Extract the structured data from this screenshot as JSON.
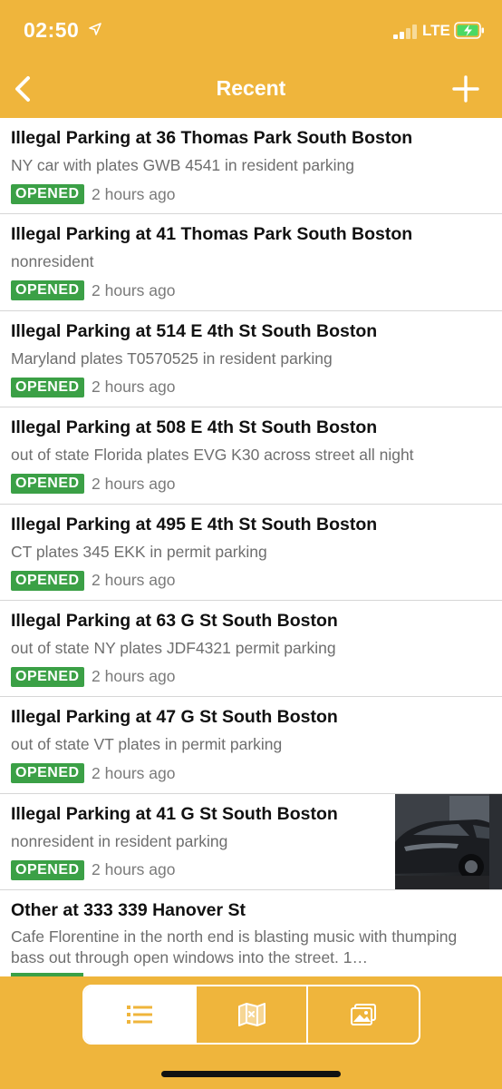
{
  "status_bar": {
    "time": "02:50",
    "network": "LTE"
  },
  "nav": {
    "title": "Recent"
  },
  "reports": [
    {
      "title": "Illegal Parking at 36 Thomas Park South Boston",
      "description": "NY car with plates GWB 4541 in resident parking",
      "status": "OPENED",
      "time": "2 hours ago"
    },
    {
      "title": "Illegal Parking at 41 Thomas Park South Boston",
      "description": "nonresident",
      "status": "OPENED",
      "time": "2 hours ago"
    },
    {
      "title": "Illegal Parking at 514 E 4th St South Boston",
      "description": "Maryland plates T0570525 in resident parking",
      "status": "OPENED",
      "time": "2 hours ago"
    },
    {
      "title": "Illegal Parking at 508 E 4th St South Boston",
      "description": "out of state Florida plates EVG K30 across street all night",
      "status": "OPENED",
      "time": "2 hours ago"
    },
    {
      "title": "Illegal Parking at 495 E 4th St South Boston",
      "description": "CT plates 345 EKK in permit parking",
      "status": "OPENED",
      "time": "2 hours ago"
    },
    {
      "title": "Illegal Parking at 63 G St South Boston",
      "description": "out of state NY plates JDF4321 permit parking",
      "status": "OPENED",
      "time": "2 hours ago"
    },
    {
      "title": "Illegal Parking at 47 G St South Boston",
      "description": "out of state VT plates in permit parking",
      "status": "OPENED",
      "time": "2 hours ago"
    },
    {
      "title": "Illegal Parking at 41 G St South Boston",
      "description": "nonresident in resident parking",
      "status": "OPENED",
      "time": "2 hours ago"
    },
    {
      "title": "Other at 333 339 Hanover St",
      "description": "Cafe Florentine in the north end is blasting music with thumping bass out through open windows into the street. 1…"
    }
  ],
  "tabs": [
    {
      "icon": "list-icon",
      "active": true
    },
    {
      "icon": "map-icon",
      "active": false
    },
    {
      "icon": "photos-icon",
      "active": false
    }
  ],
  "colors": {
    "header": "#EFB53C",
    "badge": "#3BA046",
    "title_text": "#111111",
    "secondary_text": "#6e6e6e"
  }
}
